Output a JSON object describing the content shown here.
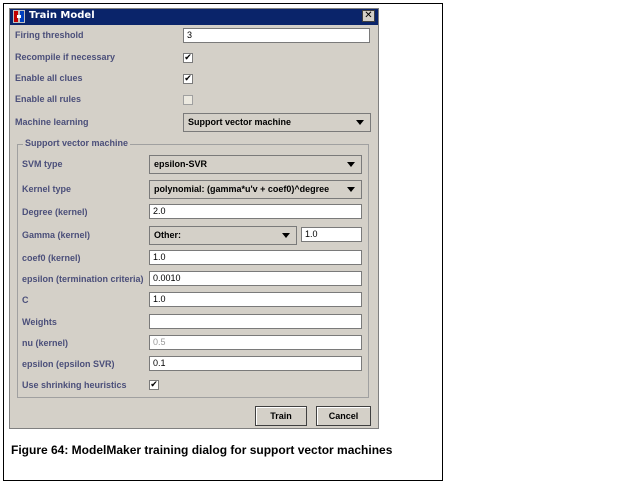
{
  "dialog": {
    "title": "Train Model",
    "close_symbol": "✕",
    "icon": "app-icon"
  },
  "fields": {
    "firing_threshold": {
      "label": "Firing threshold",
      "value": "3"
    },
    "recompile": {
      "label": "Recompile if necessary",
      "checked": true
    },
    "enable_clues": {
      "label": "Enable all clues",
      "checked": true
    },
    "enable_rules": {
      "label": "Enable all rules",
      "checked": false
    },
    "machine_learning": {
      "label": "Machine learning",
      "value": "Support vector machine"
    }
  },
  "svm": {
    "group_title": "Support vector machine",
    "svm_type": {
      "label": "SVM type",
      "value": "epsilon-SVR"
    },
    "kernel_type": {
      "label": "Kernel type",
      "value": "polynomial: (gamma*u'v + coef0)^degree"
    },
    "degree": {
      "label": "Degree (kernel)",
      "value": "2.0"
    },
    "gamma": {
      "label": "Gamma (kernel)",
      "select_value": "Other:",
      "value": "1.0"
    },
    "coef0": {
      "label": "coef0 (kernel)",
      "value": "1.0"
    },
    "epsilon_term": {
      "label": "epsilon (termination criteria)",
      "value": "0.0010"
    },
    "c": {
      "label": "C",
      "value": "1.0"
    },
    "weights": {
      "label": "Weights",
      "value": ""
    },
    "nu": {
      "label": "nu (kernel)",
      "value": "0.5"
    },
    "epsilon_svr": {
      "label": "epsilon (epsilon SVR)",
      "value": "0.1"
    },
    "shrinking": {
      "label": "Use shrinking heuristics",
      "checked": true
    }
  },
  "buttons": {
    "train": "Train",
    "cancel": "Cancel"
  },
  "caption": "Figure 64: ModelMaker training dialog for support vector machines",
  "colors": {
    "titlebar": "#0a246a",
    "dialog_bg": "#d4d0c8",
    "label": "#4b4f7a"
  }
}
